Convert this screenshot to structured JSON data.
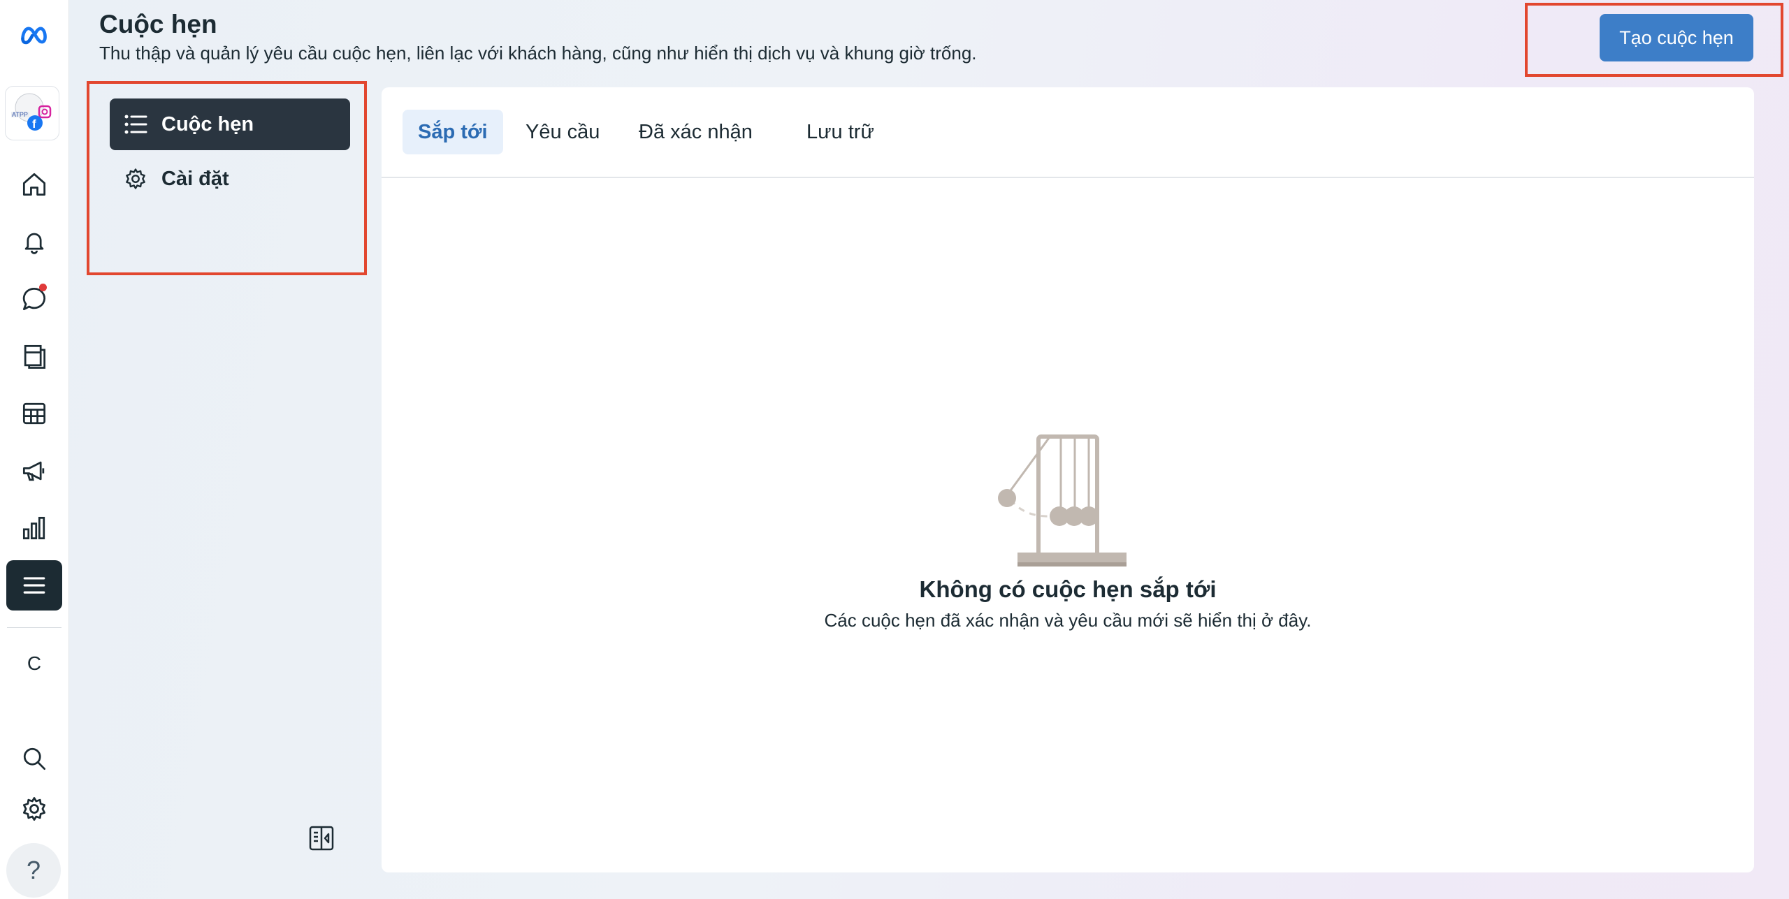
{
  "header": {
    "title": "Cuộc hẹn",
    "subtitle": "Thu thập và quản lý yêu cầu cuộc hẹn, liên lạc với khách hàng, cũng như hiển thị dịch vụ và khung giờ trống.",
    "create_button": "Tạo cuộc hẹn"
  },
  "rail": {
    "letter": "C",
    "help": "?",
    "icons": [
      "meta-logo-icon",
      "home-icon",
      "bell-icon",
      "chat-icon",
      "pages-icon",
      "table-icon",
      "megaphone-icon",
      "bar-chart-icon",
      "menu-icon",
      "search-icon",
      "gear-icon",
      "help-icon"
    ],
    "notification_color": "#e03a3a"
  },
  "side_menu": {
    "items": [
      {
        "label": "Cuộc hẹn",
        "icon": "list-icon",
        "active": true
      },
      {
        "label": "Cài đặt",
        "icon": "gear-icon",
        "active": false
      }
    ]
  },
  "tabs": [
    {
      "label": "Sắp tới",
      "active": true
    },
    {
      "label": "Yêu cầu",
      "active": false
    },
    {
      "label": "Đã xác nhận",
      "active": false
    },
    {
      "label": "Lưu trữ",
      "active": false
    }
  ],
  "empty_state": {
    "title": "Không có cuộc hẹn sắp tới",
    "subtitle": "Các cuộc hẹn đã xác nhận và yêu cầu mới sẽ hiển thị ở đây.",
    "illustration": "newtons-cradle-icon"
  },
  "colors": {
    "accent": "#3d7ec8",
    "highlight_border": "#e2472f",
    "active_menu": "#2a3540"
  }
}
